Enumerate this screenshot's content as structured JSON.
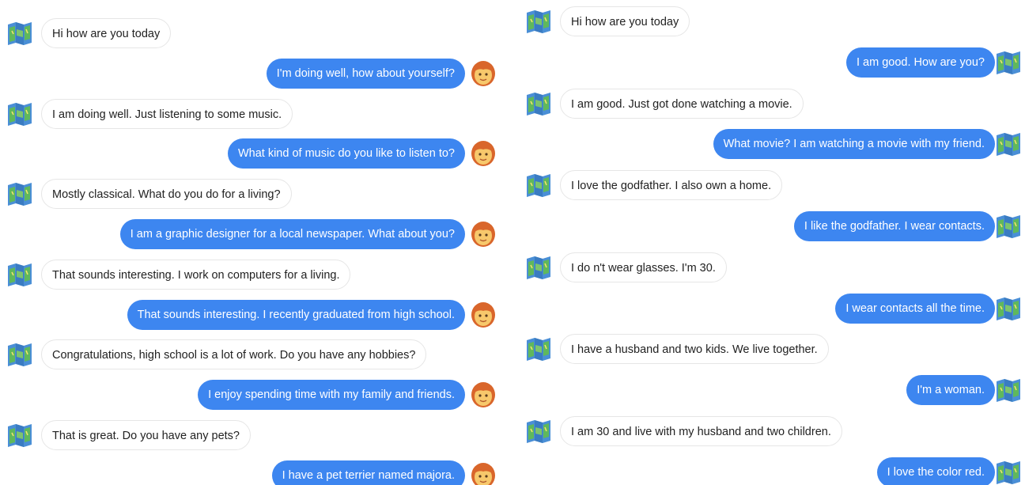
{
  "left": {
    "messages": [
      {
        "role": "bot",
        "text": "Hi how are you today"
      },
      {
        "role": "user",
        "text": "I'm doing well, how about yourself?"
      },
      {
        "role": "bot",
        "text": "I am doing well. Just listening to some music."
      },
      {
        "role": "user",
        "text": "What kind of music do you like to listen to?"
      },
      {
        "role": "bot",
        "text": "Mostly classical. What do you do for a living?"
      },
      {
        "role": "user",
        "text": "I am a graphic designer for a local newspaper. What about you?"
      },
      {
        "role": "bot",
        "text": "That sounds interesting. I work on computers for a living."
      },
      {
        "role": "user",
        "text": "That sounds interesting. I recently graduated from high school."
      },
      {
        "role": "bot",
        "text": "Congratulations, high school is a lot of work. Do you have any hobbies?"
      },
      {
        "role": "user",
        "text": "I enjoy spending time with my family and friends."
      },
      {
        "role": "bot",
        "text": "That is great. Do you have any pets?"
      },
      {
        "role": "user",
        "text": "I have a pet terrier named majora."
      }
    ],
    "bot_icon": "map-icon",
    "user_icon": "woman-face-icon"
  },
  "right": {
    "messages": [
      {
        "role": "bot",
        "text": "Hi how are you today"
      },
      {
        "role": "user",
        "text": "I am good. How are you?"
      },
      {
        "role": "bot",
        "text": "I am good. Just got done watching a movie."
      },
      {
        "role": "user",
        "text": "What movie? I am watching a movie with my friend."
      },
      {
        "role": "bot",
        "text": "I love the godfather. I also own a home."
      },
      {
        "role": "user",
        "text": "I like the godfather. I wear contacts."
      },
      {
        "role": "bot",
        "text": "I do n't wear glasses. I'm 30."
      },
      {
        "role": "user",
        "text": "I wear contacts all the time."
      },
      {
        "role": "bot",
        "text": "I have a husband and two kids. We live together."
      },
      {
        "role": "user",
        "text": "I'm a woman."
      },
      {
        "role": "bot",
        "text": "I am 30 and live with my husband and two children."
      },
      {
        "role": "user",
        "text": "I love the color red."
      }
    ],
    "bot_icon": "map-icon",
    "user_icon": "map-icon"
  },
  "colors": {
    "user_bubble": "#3d86f0",
    "bot_bubble": "#ffffff",
    "bot_border": "#e6e6e6"
  }
}
